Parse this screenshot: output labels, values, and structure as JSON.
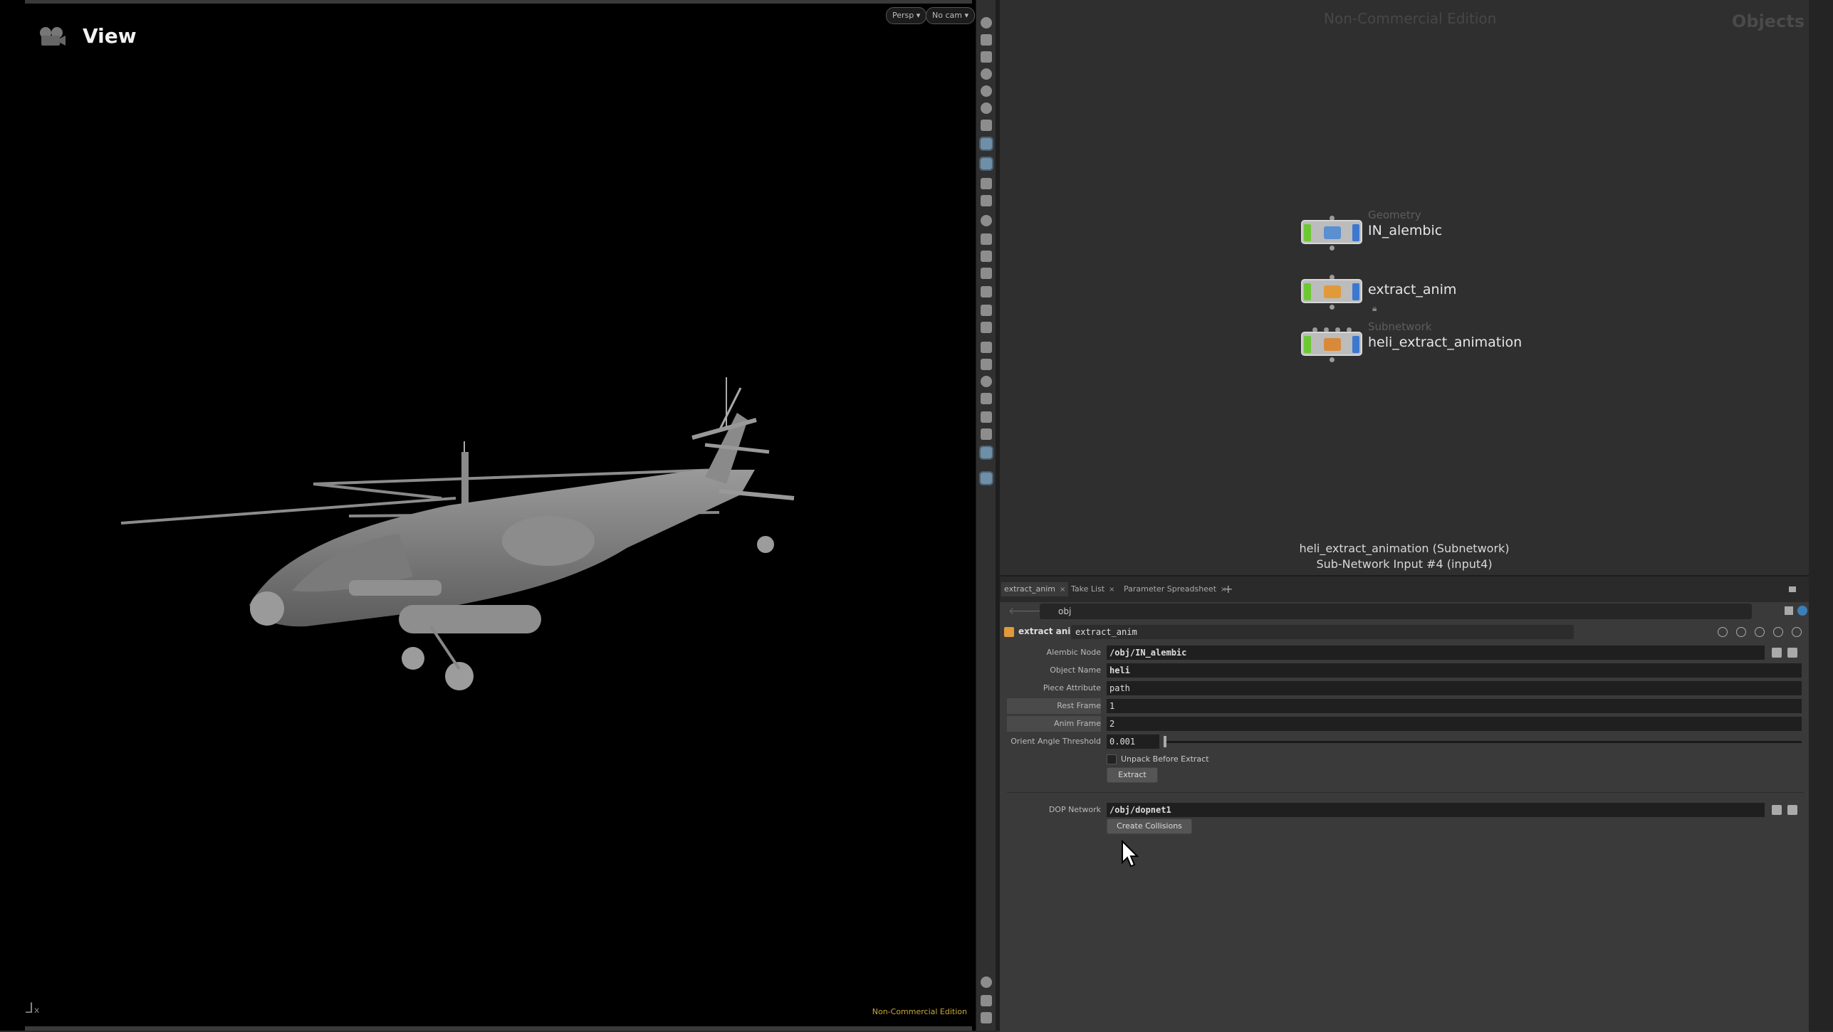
{
  "viewport": {
    "title": "View",
    "persp_label": "Persp ▾",
    "cam_label": "No cam ▾",
    "watermark": "Non-Commercial Edition"
  },
  "network": {
    "watermark": "Non-Commercial Edition",
    "context_label": "Objects",
    "nodes": [
      {
        "type": "Geometry",
        "name": "IN_alembic"
      },
      {
        "type": "",
        "name": "extract_anim"
      },
      {
        "type": "Subnetwork",
        "name": "heli_extract_animation"
      }
    ],
    "info_line1": "heli_extract_animation (Subnetwork)",
    "info_line2": "Sub-Network Input #4 (input4)"
  },
  "params": {
    "tabs": [
      {
        "label": "extract_anim"
      },
      {
        "label": "Take List"
      },
      {
        "label": "Parameter Spreadsheet"
      }
    ],
    "add_tab": "+",
    "path": "obj",
    "node_type": "extract anim",
    "node_name": "extract_anim",
    "rows": {
      "alembic_node": {
        "label": "Alembic Node",
        "value": "/obj/IN_alembic"
      },
      "object_name": {
        "label": "Object Name",
        "value": "heli"
      },
      "piece_attribute": {
        "label": "Piece Attribute",
        "value": "path"
      },
      "rest_frame": {
        "label": "Rest Frame",
        "value": "1"
      },
      "anim_frame": {
        "label": "Anim Frame",
        "value": "2"
      },
      "orient_angle": {
        "label": "Orient Angle Threshold",
        "value": "0.001"
      },
      "unpack": {
        "label": "Unpack Before Extract",
        "checked": false
      },
      "extract_button": "Extract",
      "dop_network": {
        "label": "DOP Network",
        "value": "/obj/dopnet1"
      },
      "create_collisions_button": "Create Collisions"
    }
  },
  "colors": {
    "node_flag_display": "#6cc832",
    "node_flag_render": "#3d78d0",
    "watermark_yellow": "#c8a63b"
  }
}
